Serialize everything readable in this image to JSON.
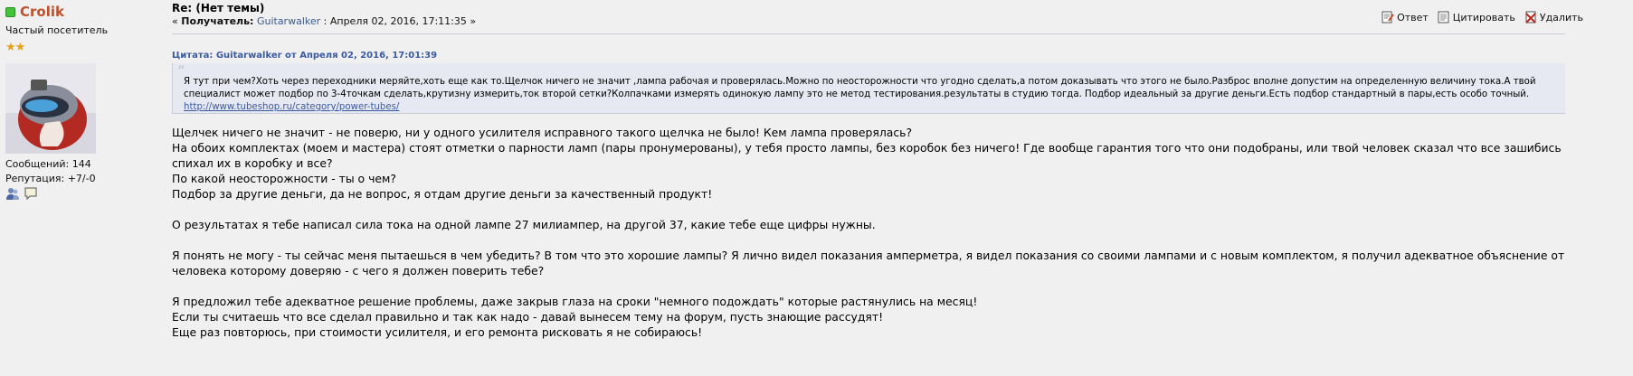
{
  "poster": {
    "name": "Crolik",
    "rank": "Частый посетитель",
    "stars": "★★",
    "posts": "Сообщений: 144",
    "reputation": "Репутация: +7/-0"
  },
  "post": {
    "subject": "Re: (Нет темы)",
    "prefix": "« ",
    "recipient_label": "Получатель:",
    "recipient": "Guitarwalker",
    "date": " : Апреля 02, 2016, 17:11:35 »"
  },
  "actions": {
    "reply": "Ответ",
    "quote": "Цитировать",
    "delete": "Удалить"
  },
  "quote": {
    "header": "Цитата: Guitarwalker от Апреля 02, 2016, 17:01:39",
    "text": "Я тут при чем?Хоть через переходники меряйте,хоть еще как то.Щелчок ничего не значит ,лампа рабочая и проверялась.Можно по неосторожности что угодно сделать,а потом доказывать что этого не было.Разброс вполне допустим на определенную величину тока.А твой специалист может подбор по 3-4точкам сделать,крутизну измерить,ток второй сетки?Колпачками измерять одинокую лампу это не метод тестирования.результаты в студию тогда. Подбор идеальный за другие деньги.Есть подбор стандартный в пары,есть особо точный. ",
    "link": "http://www.tubeshop.ru/category/power-tubes/"
  },
  "body": [
    "Щелчек ничего не значит - не поверю, ни у одного усилителя исправного такого щелчка не было! Кем лампа проверялась?",
    "На обоих комплектах (моем и мастера) стоят отметки о парности ламп (пары пронумерованы), у тебя просто лампы, без коробок без ничего! Где вообще гарантия того что они подобраны, или твой человек сказал что все зашибись спихал их в коробку и все?",
    "По какой неосторожности - ты о чем?",
    "Подбор за другие деньги, да не вопрос, я отдам другие деньги за качественный продукт!",
    "",
    "О результатах я тебе написал сила тока на одной лампе 27 милиампер, на другой 37, какие тебе еще цифры нужны.",
    "",
    "Я понять не могу - ты сейчас меня пытаешься в чем убедить? В том что это хорошие лампы? Я лично видел показания амперметра, я видел показания со своими лампами и с новым комплектом, я получил адекватное объяснение от человека которому доверяю - с чего я должен поверить тебе?",
    "",
    "Я предложил тебе адекватное решение проблемы, даже закрыв глаза на сроки \"немного подождать\" которые растянулись на месяц!",
    "Если ты считаешь что все сделал правильно и так как надо - давай вынесем тему на форум, пусть знающие рассудят!",
    "Еще раз повторюсь, при стоимости усилителя, и его ремонта рисковать я не собираюсь!"
  ]
}
